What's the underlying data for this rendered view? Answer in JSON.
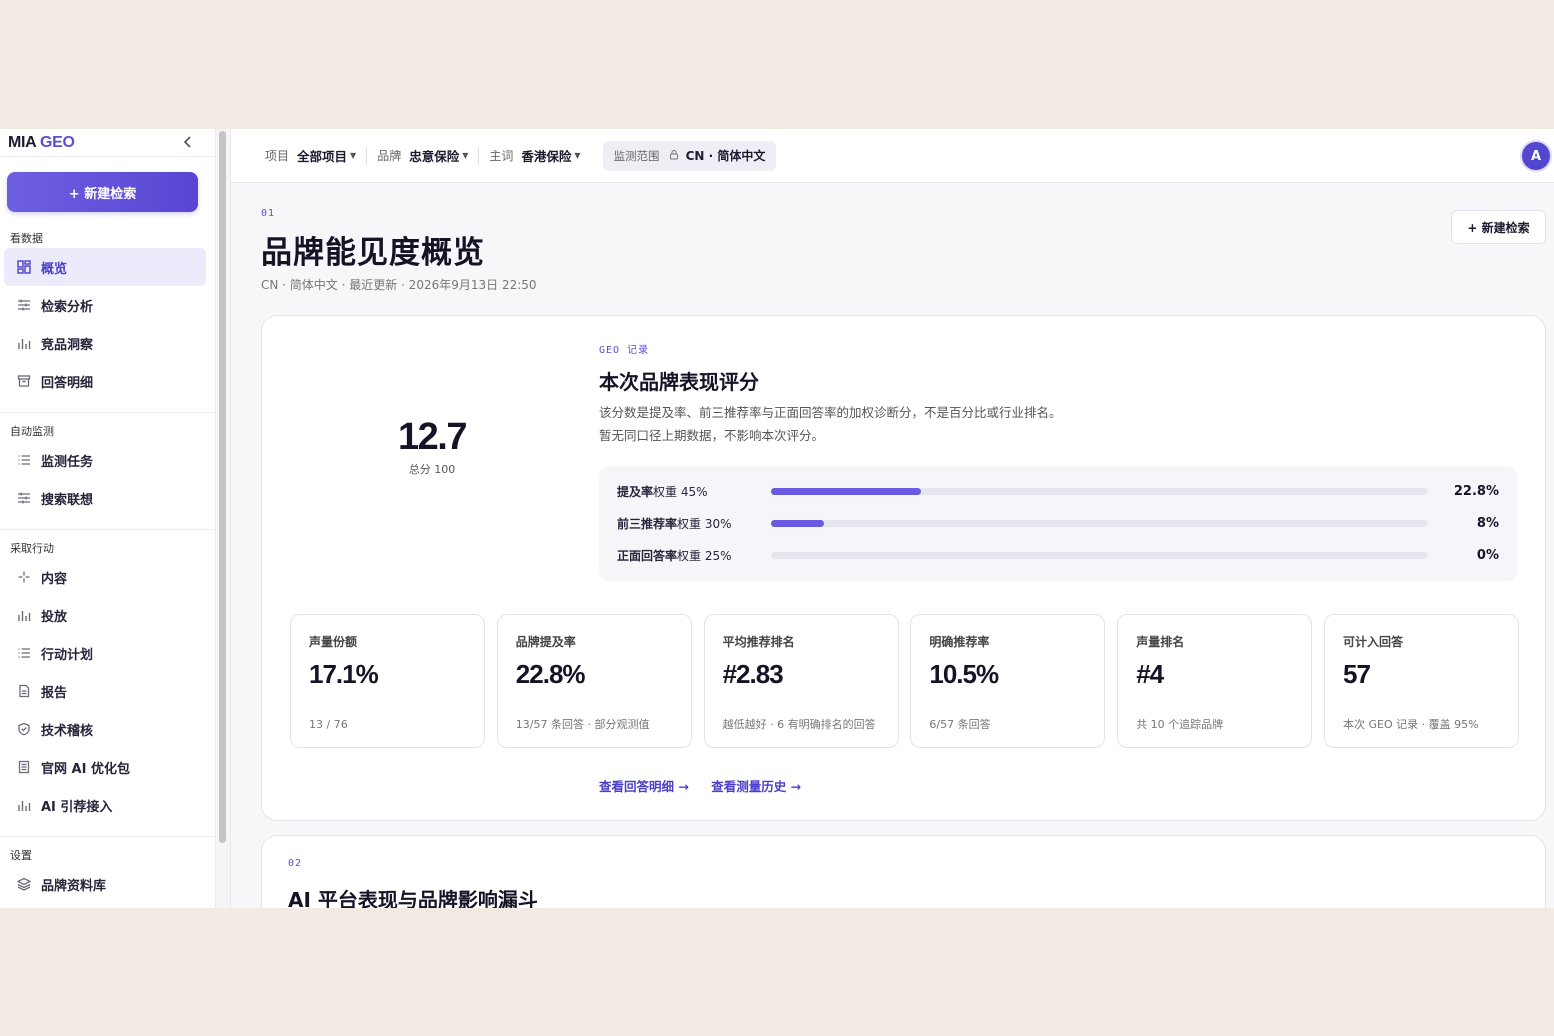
{
  "app": {
    "logo_main": "MIA",
    "logo_accent": "GEO",
    "collapse_label": "‹",
    "new_search": "+ 新建检索"
  },
  "sidebar": {
    "sections": [
      {
        "label": "看数据",
        "items": [
          {
            "label": "概览",
            "icon": "dashboard-icon",
            "active": true
          },
          {
            "label": "检索分析",
            "icon": "sliders-icon"
          },
          {
            "label": "竞品洞察",
            "icon": "bar-chart-icon"
          },
          {
            "label": "回答明细",
            "icon": "archive-icon"
          }
        ]
      },
      {
        "label": "自动监测",
        "items": [
          {
            "label": "监测任务",
            "icon": "list-icon"
          },
          {
            "label": "搜索联想",
            "icon": "sliders-icon"
          }
        ]
      },
      {
        "label": "采取行动",
        "items": [
          {
            "label": "内容",
            "icon": "sparkle-icon"
          },
          {
            "label": "投放",
            "icon": "bar-chart-icon"
          },
          {
            "label": "行动计划",
            "icon": "list-icon"
          },
          {
            "label": "报告",
            "icon": "document-icon"
          },
          {
            "label": "技术稽核",
            "icon": "shield-icon"
          },
          {
            "label": "官网 AI 优化包",
            "icon": "file-icon"
          },
          {
            "label": "AI 引荐接入",
            "icon": "bar-chart-icon"
          }
        ]
      },
      {
        "label": "设置",
        "items": [
          {
            "label": "品牌资料库",
            "icon": "layers-icon"
          }
        ]
      }
    ]
  },
  "topbar": {
    "filters": [
      {
        "key": "项目",
        "value": "全部项目"
      },
      {
        "key": "品牌",
        "value": "忠意保险"
      },
      {
        "key": "主词",
        "value": "香港保险"
      }
    ],
    "scope_label": "监测范围",
    "scope_value": "CN · 简体中文",
    "avatar": "A"
  },
  "page": {
    "section_no": "01",
    "title": "品牌能见度概览",
    "subtitle": "CN · 简体中文 · 最近更新 · 2026年9月13日 22:50",
    "new_search": "+ 新建检索"
  },
  "score_card": {
    "score": "12.7",
    "score_of": "总分 100",
    "tag": "GEO 记录",
    "title": "本次品牌表现评分",
    "desc_line1": "该分数是提及率、前三推荐率与正面回答率的加权诊断分，不是百分比或行业排名。",
    "desc_line2": "暂无同口径上期数据，不影响本次评分。",
    "weights": [
      {
        "label": "提及率",
        "weight": "权重 45%",
        "value": "22.8%",
        "pct": 22.8
      },
      {
        "label": "前三推荐率",
        "weight": "权重 30%",
        "value": "8%",
        "pct": 8
      },
      {
        "label": "正面回答率",
        "weight": "权重 25%",
        "value": "0%",
        "pct": 0
      }
    ],
    "metrics": [
      {
        "label": "声量份额",
        "value": "17.1%",
        "sub": "13 / 76"
      },
      {
        "label": "品牌提及率",
        "value": "22.8%",
        "sub": "13/57 条回答 · 部分观测值"
      },
      {
        "label": "平均推荐排名",
        "value": "#2.83",
        "sub": "越低越好 · 6 有明确排名的回答"
      },
      {
        "label": "明确推荐率",
        "value": "10.5%",
        "sub": "6/57 条回答"
      },
      {
        "label": "声量排名",
        "value": "#4",
        "sub": "共 10 个追踪品牌"
      },
      {
        "label": "可计入回答",
        "value": "57",
        "sub": "本次 GEO 记录 · 覆盖 95%"
      }
    ],
    "link_answers": "查看回答明细 →",
    "link_history": "查看测量历史 →"
  },
  "section2": {
    "section_no": "02",
    "title": "AI 平台表现与品牌影响漏斗"
  },
  "colors": {
    "accent": "#5b4fd6",
    "active_bg": "#ecebfb"
  }
}
